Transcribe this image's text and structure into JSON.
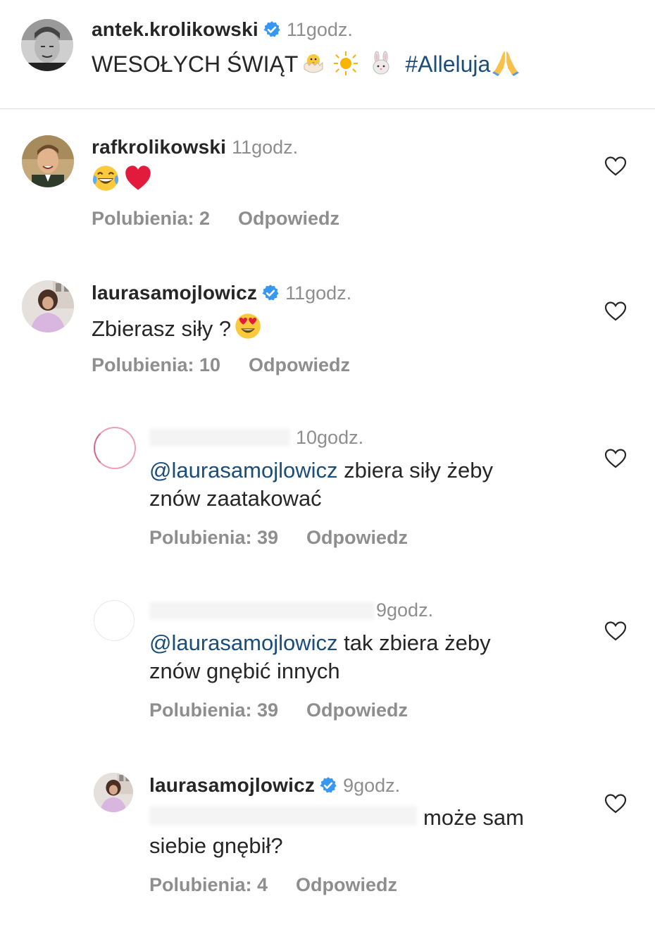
{
  "post": {
    "username": "antek.krolikowski",
    "time": "11godz.",
    "caption": "WESOŁYCH ŚWIĄT",
    "hashtag": "#Alleluja",
    "emojis": [
      "chick-icon",
      "sun-icon",
      "rabbit-icon",
      "praying-hands-icon"
    ]
  },
  "comments": [
    {
      "username": "rafkrolikowski",
      "verified": false,
      "time": "11godz.",
      "text": "",
      "emojis": [
        "laughing-tears-icon",
        "red-heart-icon"
      ],
      "likes": "Polubienia: 2",
      "reply": "Odpowiedz"
    },
    {
      "username": "laurasamojlowicz",
      "verified": true,
      "time": "11godz.",
      "text": "Zbierasz siły ?",
      "emojis": [
        "heart-eyes-icon"
      ],
      "likes": "Polubienia: 10",
      "reply": "Odpowiedz"
    },
    {
      "username": "",
      "verified": false,
      "time": "10godz.",
      "mention": "@laurasamojlowicz",
      "text_line1": "zbiera siły żeby",
      "text_line2": "znów zaatakować",
      "likes": "Polubienia: 39",
      "reply": "Odpowiedz"
    },
    {
      "username": "",
      "verified": false,
      "time": "9godz.",
      "mention": "@laurasamojlowicz",
      "text_line1": "tak zbiera żeby",
      "text_line2": "znów gnębić innych",
      "likes": "Polubienia: 39",
      "reply": "Odpowiedz"
    },
    {
      "username": "laurasamojlowicz",
      "verified": true,
      "time": "9godz.",
      "text_line1": "może sam",
      "text_line2": "siebie gnębił?",
      "likes": "Polubienia: 4",
      "reply": "Odpowiedz"
    }
  ],
  "colors": {
    "text": "#262626",
    "muted": "#8e8e8e",
    "link": "#1b4d7a",
    "verified": "#3897f0"
  }
}
